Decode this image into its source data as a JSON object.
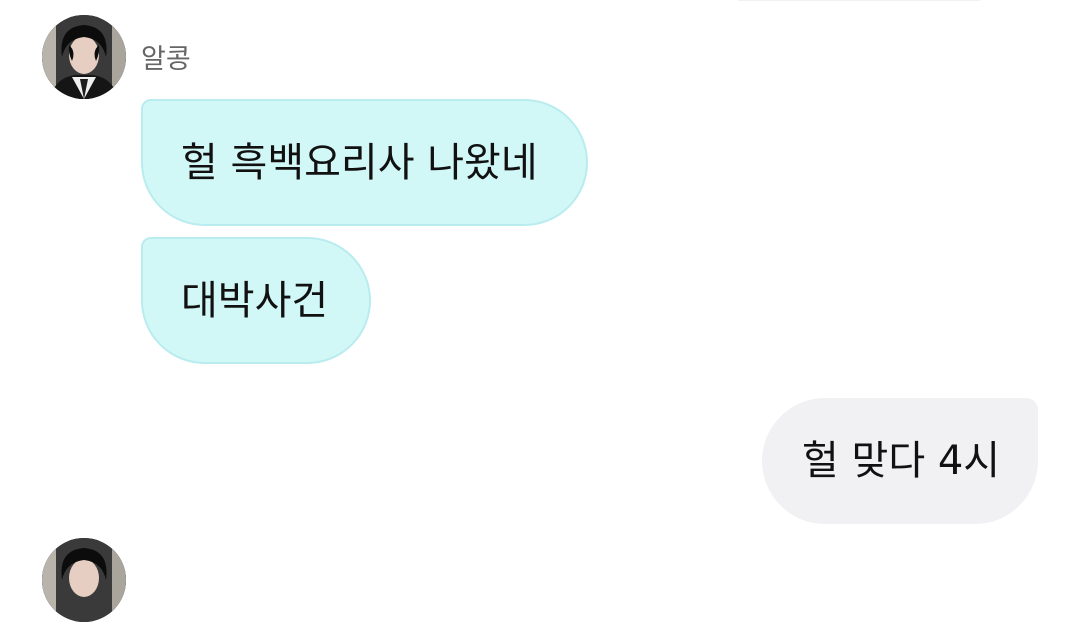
{
  "chat": {
    "sender_name": "알콩",
    "incoming_messages": [
      "헐 흑백요리사 나왔네",
      "대박사건"
    ],
    "outgoing_messages": [
      "헐 맞다 4시"
    ]
  },
  "icons": {
    "avatar": "user-avatar-photo"
  },
  "colors": {
    "incoming_bubble": "#d2f7f7",
    "incoming_border": "#b9ecef",
    "outgoing_bubble": "#f1f1f4",
    "sender_name_text": "#666666",
    "message_text": "#111111"
  }
}
